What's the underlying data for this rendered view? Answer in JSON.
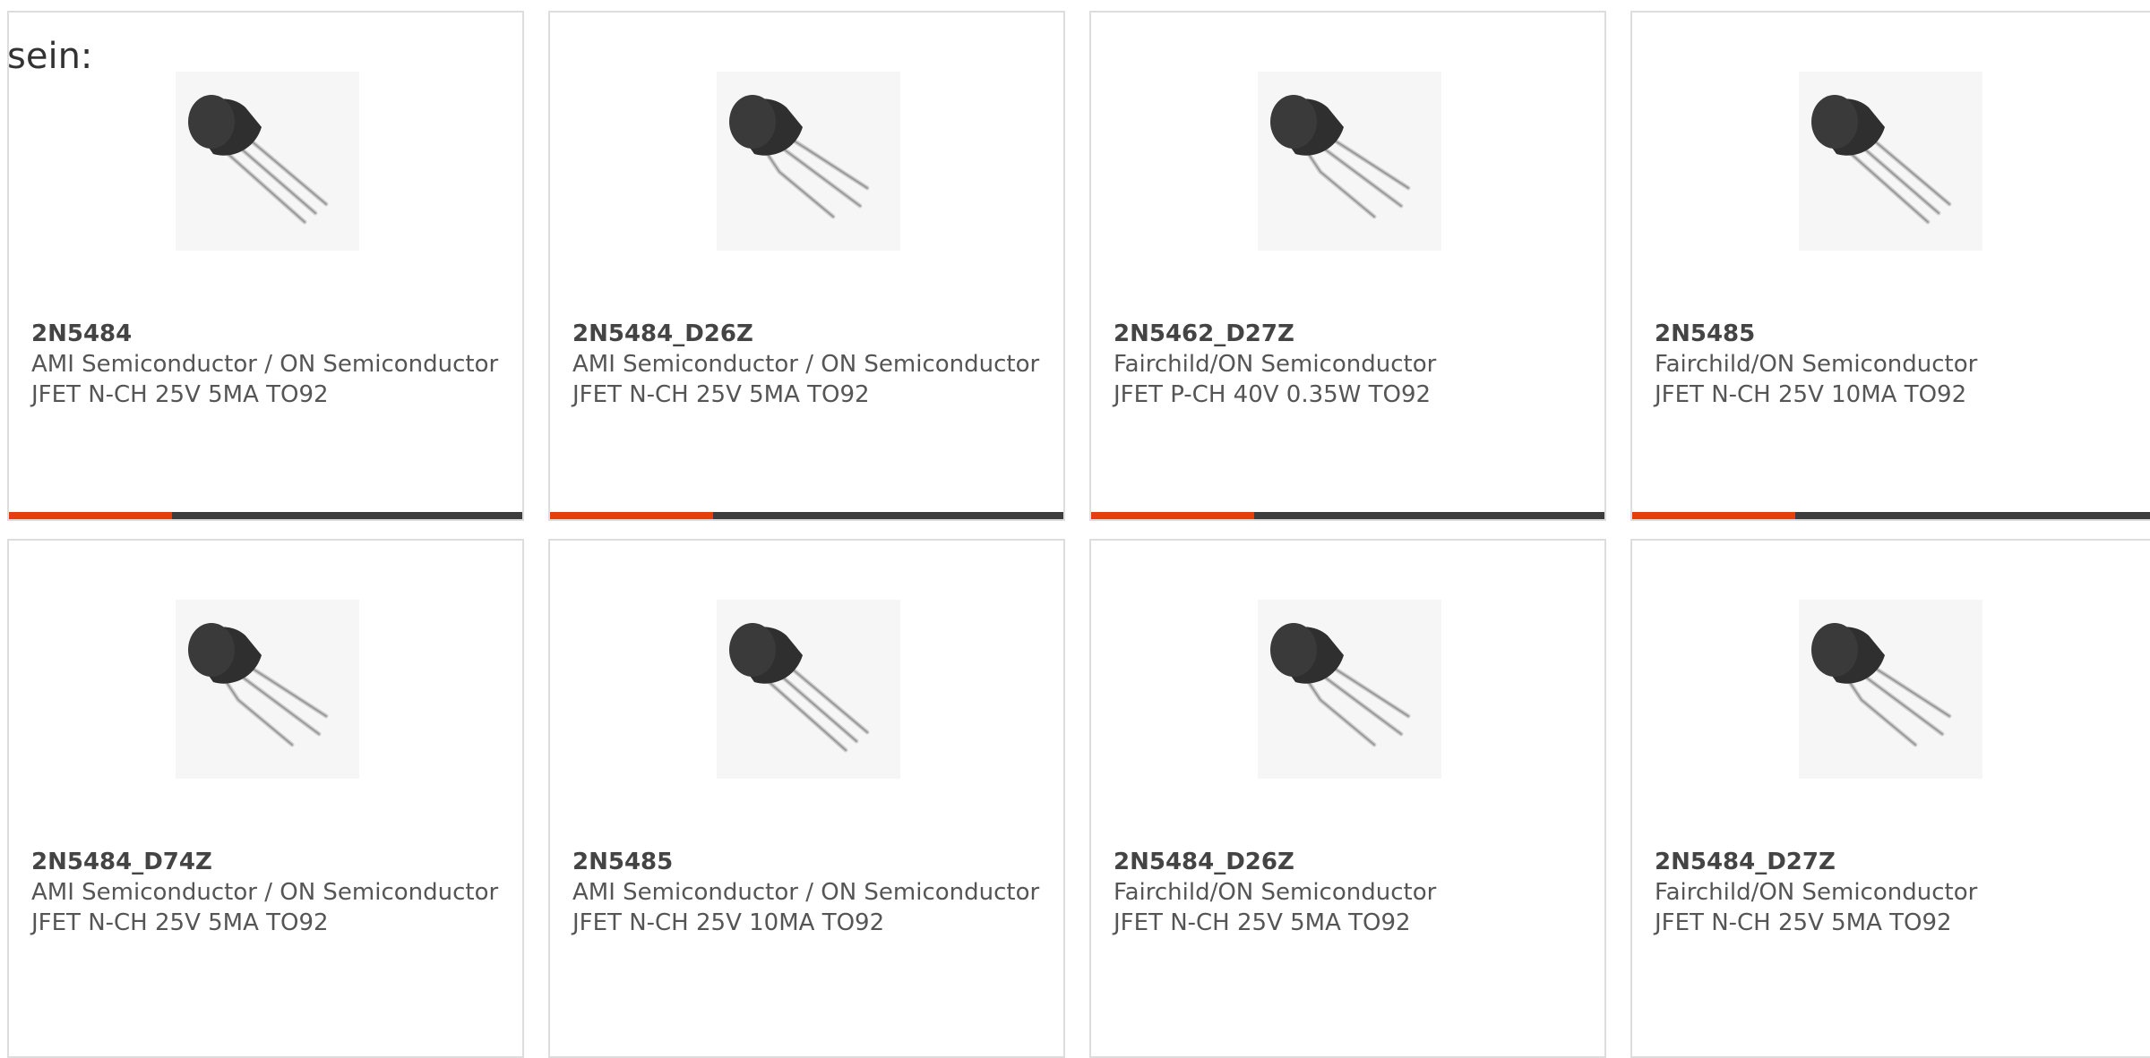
{
  "intro_text": "sein:",
  "colors": {
    "accent": "#e3400b",
    "bar": "#3d3d3d",
    "card_border": "#dddddd",
    "text": "#555555"
  },
  "products": [
    {
      "part_number": "2N5484",
      "manufacturer": "AMI Semiconductor / ON Semiconductor",
      "description": "JFET N-CH 25V 5MA TO92",
      "image_icon": "to92-transistor-straight-leads-icon"
    },
    {
      "part_number": "2N5484_D26Z",
      "manufacturer": "AMI Semiconductor / ON Semiconductor",
      "description": "JFET N-CH 25V 5MA TO92",
      "image_icon": "to92-transistor-bent-leads-icon"
    },
    {
      "part_number": "2N5462_D27Z",
      "manufacturer": "Fairchild/ON Semiconductor",
      "description": "JFET P-CH 40V 0.35W TO92",
      "image_icon": "to92-transistor-bent-leads-icon"
    },
    {
      "part_number": "2N5485",
      "manufacturer": "Fairchild/ON Semiconductor",
      "description": "JFET N-CH 25V 10MA TO92",
      "image_icon": "to92-transistor-straight-leads-icon"
    },
    {
      "part_number": "2N5484_D74Z",
      "manufacturer": "AMI Semiconductor / ON Semiconductor",
      "description": "JFET N-CH 25V 5MA TO92",
      "image_icon": "to92-transistor-bent-leads-icon"
    },
    {
      "part_number": "2N5485",
      "manufacturer": "AMI Semiconductor / ON Semiconductor",
      "description": "JFET N-CH 25V 10MA TO92",
      "image_icon": "to92-transistor-straight-leads-icon"
    },
    {
      "part_number": "2N5484_D26Z",
      "manufacturer": "Fairchild/ON Semiconductor",
      "description": "JFET N-CH 25V 5MA TO92",
      "image_icon": "to92-transistor-bent-leads-icon"
    },
    {
      "part_number": "2N5484_D27Z",
      "manufacturer": "Fairchild/ON Semiconductor",
      "description": "JFET N-CH 25V 5MA TO92",
      "image_icon": "to92-transistor-bent-leads-icon"
    }
  ]
}
